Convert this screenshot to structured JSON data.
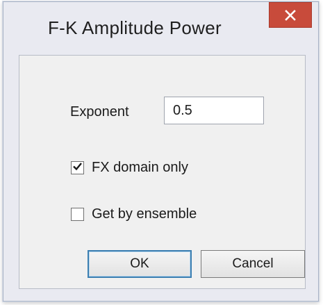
{
  "window": {
    "title": "F-K Amplitude Power",
    "close_icon": "close-icon"
  },
  "form": {
    "exponent_label": "Exponent",
    "exponent_value": "0.5",
    "fx_domain_label": "FX domain only",
    "fx_domain_checked": true,
    "ensemble_label": "Get by ensemble",
    "ensemble_checked": false
  },
  "buttons": {
    "ok_label": "OK",
    "cancel_label": "Cancel"
  },
  "colors": {
    "close_button": "#c84b3b",
    "default_button_border": "#3c7fb1"
  }
}
